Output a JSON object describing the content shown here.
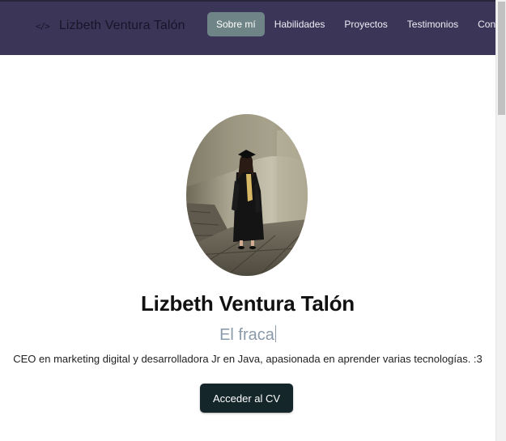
{
  "brand": {
    "icon_glyph": "</>",
    "icon": "code-icon",
    "name": "Lizbeth Ventura Talón"
  },
  "nav": {
    "items": [
      {
        "label": "Sobre mí",
        "active": true
      },
      {
        "label": "Habilidades",
        "active": false
      },
      {
        "label": "Proyectos",
        "active": false
      },
      {
        "label": "Testimonios",
        "active": false
      },
      {
        "label": "Contacto",
        "active": false
      }
    ]
  },
  "hero": {
    "name": "Lizbeth Ventura Talón",
    "typed_text": "El fraca",
    "description": "CEO en marketing digital y desarrolladora Jr en Java, apasionada en aprender varias tecnologías. :3",
    "cv_button_label": "Acceder al CV"
  },
  "colors": {
    "navbar_bg": "#3b3658",
    "active_nav_bg": "#6f8486",
    "button_bg": "#15262a",
    "typed_text": "#8a9aaa"
  }
}
